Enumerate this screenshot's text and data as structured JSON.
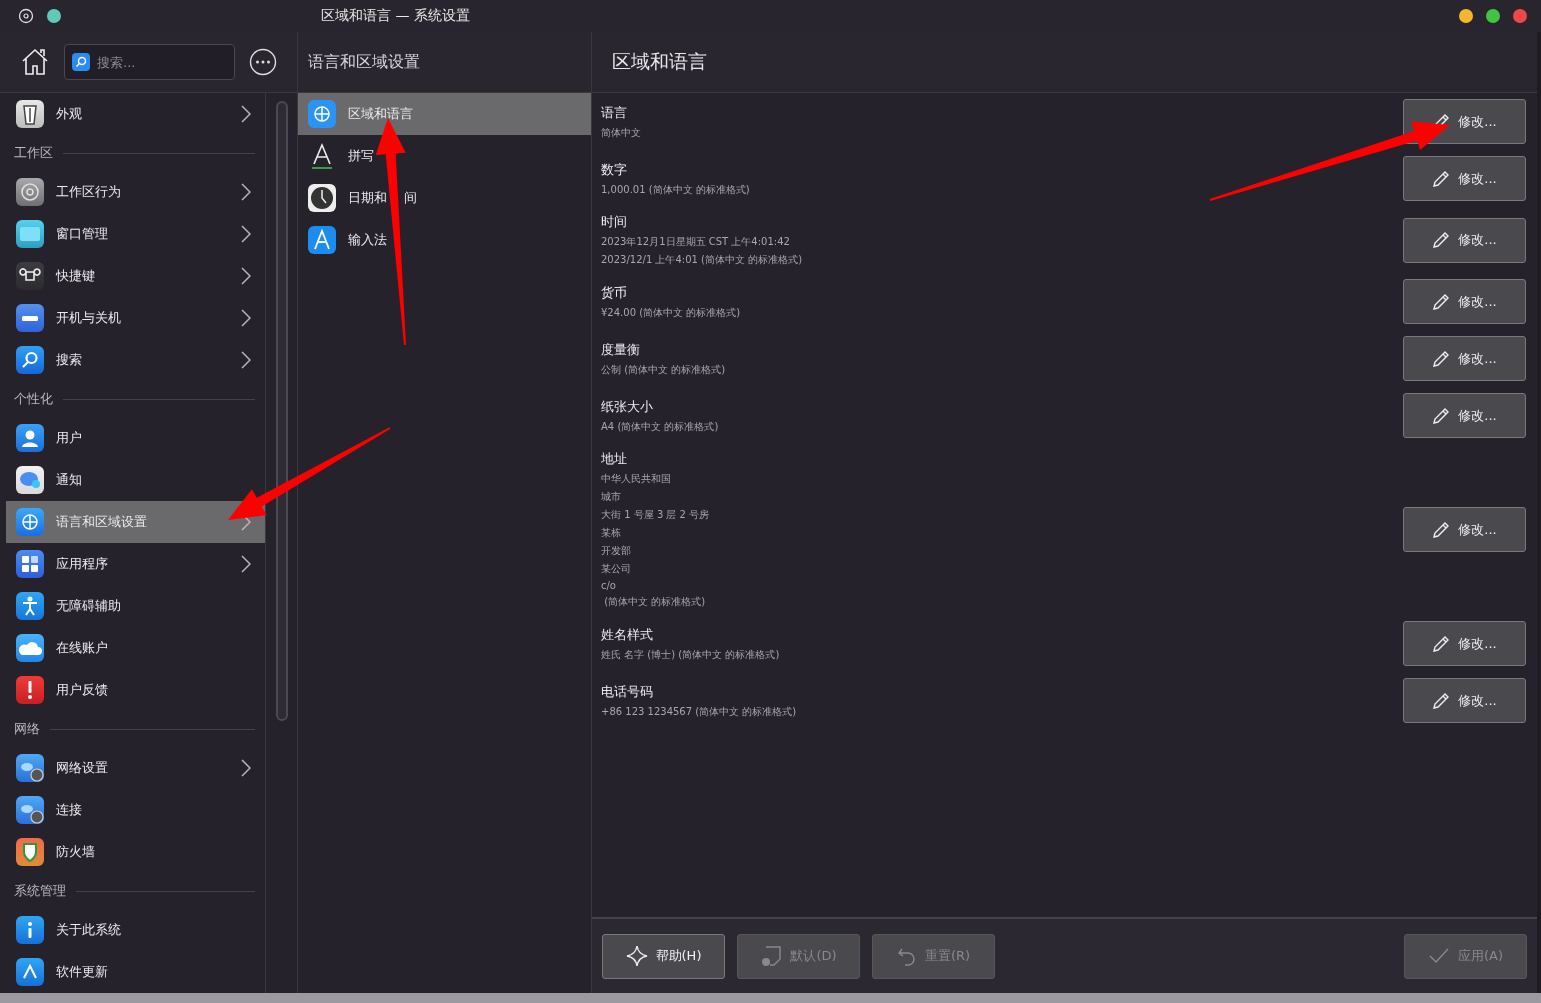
{
  "window": {
    "title": "区域和语言 — 系统设置"
  },
  "sidebar": {
    "search": {
      "placeholder": "搜索..."
    },
    "groups": [
      {
        "items": [
          {
            "label": "外观",
            "chevron": true,
            "selected": false
          }
        ]
      },
      {
        "heading": "工作区",
        "items": [
          {
            "label": "工作区行为",
            "chevron": true,
            "selected": false
          },
          {
            "label": "窗口管理",
            "chevron": true,
            "selected": false
          },
          {
            "label": "快捷键",
            "chevron": true,
            "selected": false
          },
          {
            "label": "开机与关机",
            "chevron": true,
            "selected": false
          },
          {
            "label": "搜索",
            "chevron": true,
            "selected": false
          }
        ]
      },
      {
        "heading": "个性化",
        "items": [
          {
            "label": "用户",
            "chevron": false,
            "selected": false
          },
          {
            "label": "通知",
            "chevron": false,
            "selected": false
          },
          {
            "label": "语言和区域设置",
            "chevron": true,
            "selected": true
          },
          {
            "label": "应用程序",
            "chevron": true,
            "selected": false
          },
          {
            "label": "无障碍辅助",
            "chevron": false,
            "selected": false
          },
          {
            "label": "在线账户",
            "chevron": false,
            "selected": false
          },
          {
            "label": "用户反馈",
            "chevron": false,
            "selected": false
          }
        ]
      },
      {
        "heading": "网络",
        "items": [
          {
            "label": "网络设置",
            "chevron": true,
            "selected": false
          },
          {
            "label": "连接",
            "chevron": false,
            "selected": false
          },
          {
            "label": "防火墙",
            "chevron": false,
            "selected": false
          }
        ]
      },
      {
        "heading": "系统管理",
        "items": [
          {
            "label": "关于此系统",
            "chevron": false,
            "selected": false
          },
          {
            "label": "软件更新",
            "chevron": false,
            "selected": false
          }
        ]
      }
    ]
  },
  "subpanel": {
    "title": "语言和区域设置",
    "items": [
      {
        "label": "区域和语言",
        "selected": true
      },
      {
        "label": "拼写",
        "selected": false
      },
      {
        "label": "日期和    间",
        "selected": false
      },
      {
        "label": "输入法",
        "selected": false
      }
    ]
  },
  "content": {
    "title": "区域和语言",
    "settings": [
      {
        "label": "语言",
        "lines": [
          "简体中文"
        ],
        "button": "修改..."
      },
      {
        "label": "数字",
        "lines": [
          "1,000.01 (简体中文 的标准格式)"
        ],
        "button": "修改..."
      },
      {
        "label": "时间",
        "lines": [
          "2023年12月1日星期五 CST 上午4:01:42",
          "2023/12/1 上午4:01 (简体中文 的标准格式)"
        ],
        "button": "修改..."
      },
      {
        "label": "货币",
        "lines": [
          "¥24.00 (简体中文 的标准格式)"
        ],
        "button": "修改..."
      },
      {
        "label": "度量衡",
        "lines": [
          "公制 (简体中文 的标准格式)"
        ],
        "button": "修改..."
      },
      {
        "label": "纸张大小",
        "lines": [
          "A4 (简体中文 的标准格式)"
        ],
        "button": "修改..."
      },
      {
        "label": "地址",
        "lines": [
          "中华人民共和国",
          "城市",
          "大街 1 号屋 3 层 2 号房",
          "某栋",
          "开发部",
          "某公司",
          "c/o",
          " (简体中文 的标准格式)"
        ],
        "button": "修改..."
      },
      {
        "label": "姓名样式",
        "lines": [
          "姓氏 名字 (博士) (简体中文 的标准格式)"
        ],
        "button": "修改..."
      },
      {
        "label": "电话号码",
        "lines": [
          "+86 123 1234567 (简体中文 的标准格式)"
        ],
        "button": "修改..."
      }
    ],
    "footer": [
      {
        "kind": "help",
        "label": "帮助(H)",
        "disabled": false
      },
      {
        "kind": "defaults",
        "label": "默认(D)",
        "disabled": true
      },
      {
        "kind": "reset",
        "label": "重置(R)",
        "disabled": true
      },
      {
        "kind": "apply",
        "label": "应用(A)",
        "disabled": true
      }
    ]
  }
}
